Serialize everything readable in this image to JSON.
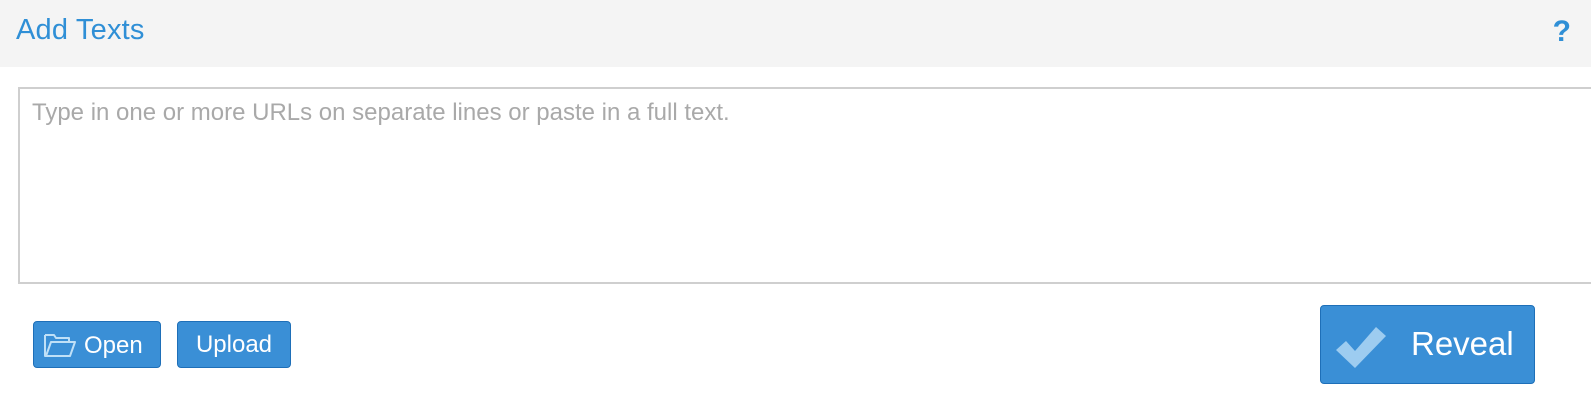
{
  "header": {
    "title": "Add Texts",
    "help_label": "?"
  },
  "input": {
    "placeholder": "Type in one or more URLs on separate lines or paste in a full text.",
    "value": ""
  },
  "buttons": {
    "open_label": "Open",
    "upload_label": "Upload",
    "reveal_label": "Reveal"
  },
  "icons": {
    "open": "folder-open-icon",
    "reveal": "checkmark-icon"
  },
  "colors": {
    "accent": "#3a8fd6",
    "title": "#2f8fd6",
    "header_bg": "#f4f4f4",
    "placeholder": "#a9a9a9"
  }
}
